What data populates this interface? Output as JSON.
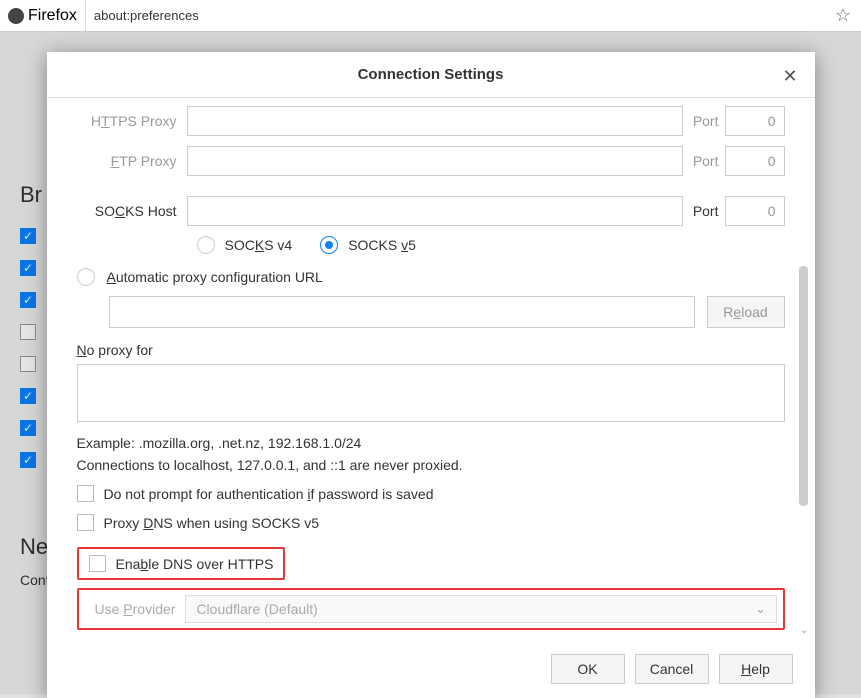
{
  "urlbar": {
    "app": "Firefox",
    "url": "about:preferences"
  },
  "background": {
    "browsing_heading": "Br",
    "net_heading": "Ne",
    "conf": "Conf"
  },
  "modal": {
    "title": "Connection Settings",
    "https_proxy_label": "HTTPS Proxy",
    "ftp_proxy_label": "FTP Proxy",
    "socks_host_label": "SOCKS Host",
    "port_label": "Port",
    "port_value": "0",
    "socks_v4": "SOCKS v4",
    "socks_v5": "SOCKS v5",
    "auto_proxy": "Automatic proxy configuration URL",
    "reload": "Reload",
    "no_proxy_label": "No proxy for",
    "example": "Example: .mozilla.org, .net.nz, 192.168.1.0/24",
    "localhost_hint": "Connections to localhost, 127.0.0.1, and ::1 are never proxied.",
    "no_prompt": "Do not prompt for authentication if password is saved",
    "proxy_dns": "Proxy DNS when using SOCKS v5",
    "enable_doh": "Enable DNS over HTTPS",
    "use_provider": "Use Provider",
    "provider_value": "Cloudflare (Default)",
    "ok": "OK",
    "cancel": "Cancel",
    "help": "Help"
  }
}
